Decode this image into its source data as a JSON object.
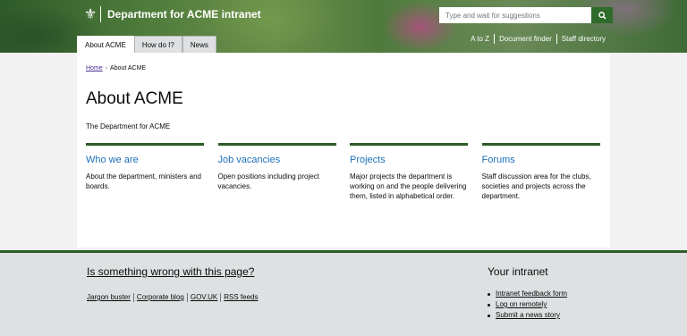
{
  "header": {
    "site_title": "Department for ACME intranet",
    "search_placeholder": "Type and wait for suggestions",
    "crest_icon": "crest-icon",
    "tabs": [
      {
        "label": "About ACME",
        "active": true
      },
      {
        "label": "How do I?",
        "active": false
      },
      {
        "label": "News",
        "active": false
      }
    ],
    "utility_links": [
      "A to Z",
      "Document finder",
      "Staff directory"
    ]
  },
  "breadcrumb": {
    "home": "Home",
    "current": "About ACME"
  },
  "page": {
    "title": "About ACME",
    "lede": "The Department for ACME"
  },
  "cards": [
    {
      "title": "Who we are",
      "desc": "About the department, ministers and boards."
    },
    {
      "title": "Job vacancies",
      "desc": "Open positions including project vacancies."
    },
    {
      "title": "Projects",
      "desc": "Major projects the department is working on and the people delivering them, listed in alphabetical order."
    },
    {
      "title": "Forums",
      "desc": "Staff discussion area for the clubs, societies and projects across the department."
    }
  ],
  "footer": {
    "feedback_link": "Is something wrong with this page?",
    "links": [
      "Jargon buster",
      "Corporate blog",
      "GOV.UK",
      "RSS feeds"
    ],
    "intranet_heading": "Your intranet",
    "intranet_links": [
      "Intranet feedback form",
      "Log on remotely",
      "Submit a news story"
    ]
  },
  "colors": {
    "brand_green": "#2c5b27",
    "link_blue": "#1d70b8",
    "visited_purple": "#4c2c92"
  }
}
